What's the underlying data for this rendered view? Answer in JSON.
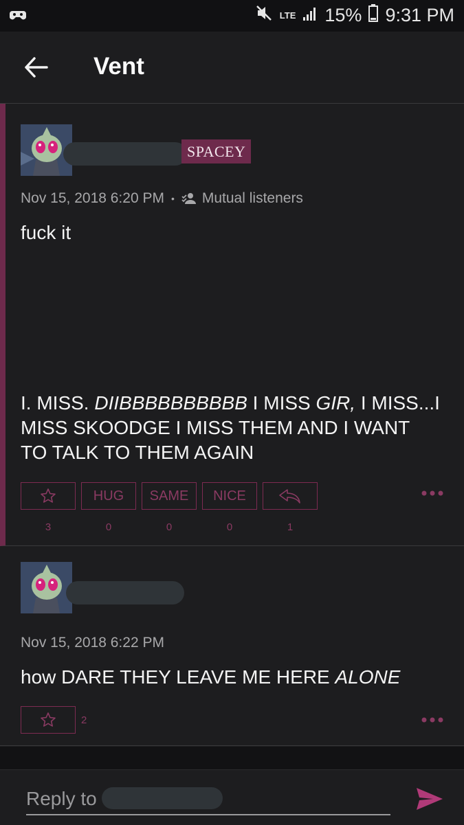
{
  "status_bar": {
    "network": "LTE",
    "battery": "15%",
    "time": "9:31 PM"
  },
  "app_bar": {
    "title": "Vent"
  },
  "post": {
    "badge": "SPACEY",
    "timestamp": "Nov 15, 2018 6:20 PM",
    "separator": "•",
    "audience": "Mutual listeners",
    "text_line1": "fuck it",
    "line1_a": "I. MISS. ",
    "line1_b": "DIIBBBBBBBBBB",
    "line1_c": " I MISS ",
    "line1_d": "GIR,",
    "line1_e": " I MISS...I",
    "line2": "MISS SKOODGE I MISS THEM AND I WANT",
    "line3": "TO TALK TO THEM AGAIN",
    "reactions": [
      {
        "label": "",
        "icon": "star-icon",
        "count": "3"
      },
      {
        "label": "HUG",
        "count": "0"
      },
      {
        "label": "SAME",
        "count": "0"
      },
      {
        "label": "NICE",
        "count": "0"
      },
      {
        "label": "",
        "icon": "reply-arrow-icon",
        "count": "1"
      }
    ]
  },
  "comment": {
    "timestamp": "Nov 15, 2018 6:22 PM",
    "text_a": "how DARE THEY LEAVE ME HERE ",
    "text_b": "ALONE",
    "star_count": "2"
  },
  "reply_bar": {
    "placeholder": "Reply to"
  },
  "colors": {
    "accent": "#6e2a4c",
    "reaction_border": "#7e2b52",
    "background": "#1d1d1f"
  }
}
